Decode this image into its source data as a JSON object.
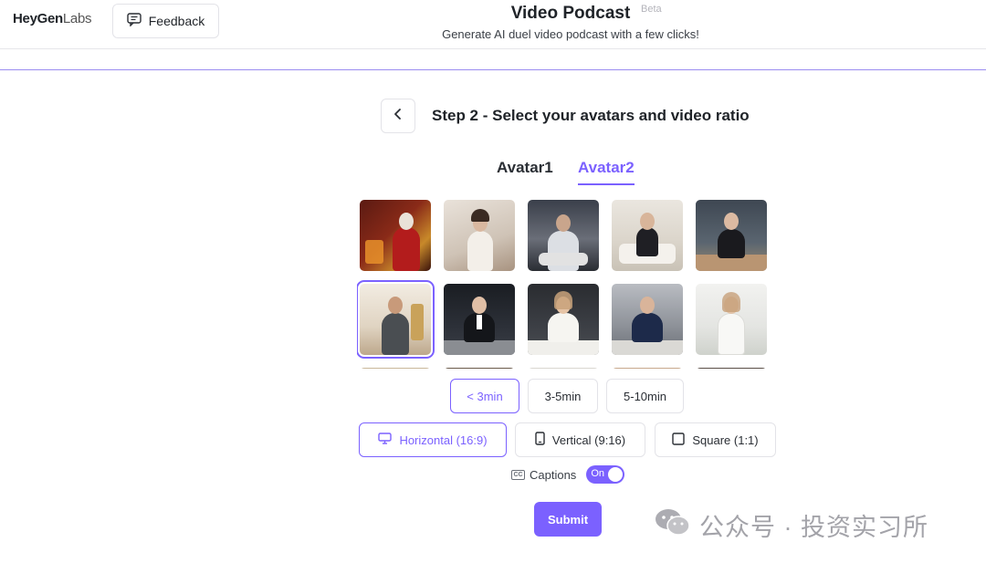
{
  "header": {
    "logo_strong": "HeyGen",
    "logo_light": "Labs",
    "feedback_label": "Feedback",
    "title": "Video Podcast",
    "beta": "Beta",
    "subtitle": "Generate AI duel video podcast with a few clicks!"
  },
  "step": {
    "back_icon": "chevron-left-icon",
    "title": "Step 2 - Select your avatars and video ratio"
  },
  "tabs": [
    {
      "label": "Avatar1",
      "active": false
    },
    {
      "label": "Avatar2",
      "active": true
    }
  ],
  "avatars": {
    "selected_index": 5,
    "colors": {
      "accent": "#7b61ff"
    }
  },
  "durations": [
    {
      "label": "< 3min",
      "active": true
    },
    {
      "label": "3-5min",
      "active": false
    },
    {
      "label": "5-10min",
      "active": false
    }
  ],
  "ratios": [
    {
      "label": "Horizontal (16:9)",
      "icon": "monitor-icon",
      "active": true
    },
    {
      "label": "Vertical (9:16)",
      "icon": "phone-icon",
      "active": false
    },
    {
      "label": "Square (1:1)",
      "icon": "square-icon",
      "active": false
    }
  ],
  "captions": {
    "icon_text": "CC",
    "label": "Captions",
    "toggle_text": "On",
    "enabled": true
  },
  "submit_label": "Submit",
  "watermark": {
    "text": "公众号 · 投资实习所",
    "icon": "wechat-icon"
  }
}
